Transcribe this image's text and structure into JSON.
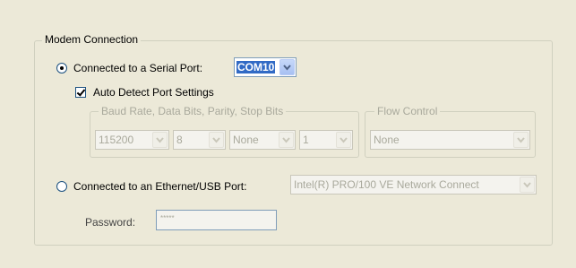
{
  "modem_group": {
    "title": "Modem Connection"
  },
  "serial": {
    "label": "Connected to a Serial Port:",
    "selected": true,
    "port_value": "COM10"
  },
  "auto_detect": {
    "label": "Auto Detect Port Settings",
    "checked": true
  },
  "port_settings": {
    "title": "Baud Rate, Data Bits, Parity, Stop Bits",
    "baud": "115200",
    "data_bits": "8",
    "parity": "None",
    "stop_bits": "1"
  },
  "flow_control": {
    "title": "Flow Control",
    "value": "None"
  },
  "ethernet": {
    "label": "Connected to an Ethernet/USB Port:",
    "selected": false,
    "port_value": "Intel(R) PRO/100 VE Network Connect"
  },
  "password": {
    "label": "Password:",
    "value": "*****"
  }
}
